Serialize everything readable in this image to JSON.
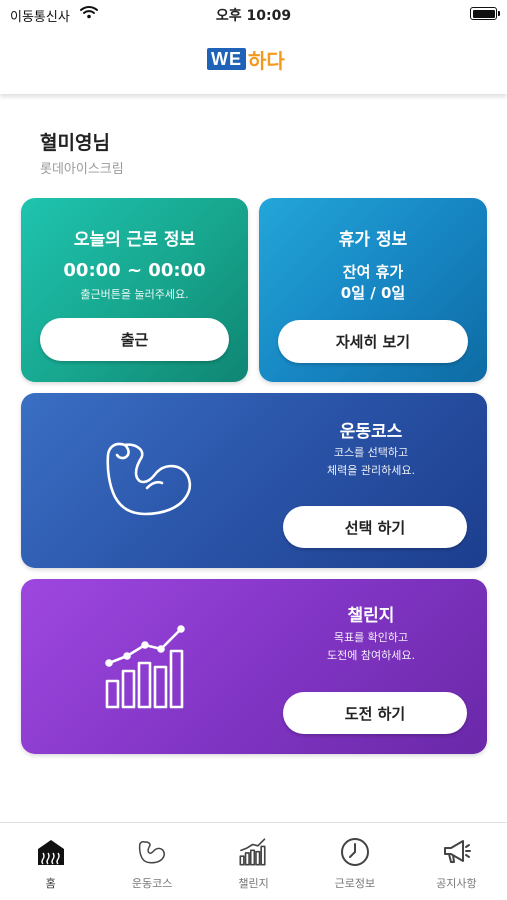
{
  "status_bar": {
    "carrier": "이동통신사",
    "time": "오후 10:09"
  },
  "header": {
    "logo_we": "WE",
    "logo_hada": "하다"
  },
  "user": {
    "name": "혈미영님",
    "company": "롯데아이스크림"
  },
  "work_card": {
    "title": "오늘의 근로 정보",
    "time_range": "00:00 ~ 00:00",
    "hint": "출근버튼을 눌러주세요.",
    "button_label": "출근"
  },
  "leave_card": {
    "title": "휴가 정보",
    "remain_label": "잔여 휴가",
    "remain_value": "0일 / 0일",
    "button_label": "자세히 보기"
  },
  "exercise_card": {
    "icon": "flexed-arm-icon",
    "title": "운동코스",
    "line1": "코스를 선택하고",
    "line2": "체력을 관리하세요.",
    "button_label": "선택 하기"
  },
  "challenge_card": {
    "icon": "bar-chart-trend-icon",
    "title": "챌린지",
    "line1": "목표를 확인하고",
    "line2": "도전에 참여하세요.",
    "button_label": "도전 하기"
  },
  "tabs": [
    {
      "label": "홈",
      "icon": "home-icon",
      "active": true
    },
    {
      "label": "운동코스",
      "icon": "flexed-arm-icon",
      "active": false
    },
    {
      "label": "챌린지",
      "icon": "bar-chart-icon",
      "active": false
    },
    {
      "label": "근로정보",
      "icon": "clock-icon",
      "active": false
    },
    {
      "label": "공지사항",
      "icon": "megaphone-icon",
      "active": false
    }
  ],
  "colors": {
    "work_card": "#17a58d",
    "leave_card": "#1684c1",
    "exercise_card": "#2a54a8",
    "challenge_card": "#8336c6",
    "logo_blue": "#1f63b8",
    "logo_orange": "#f39a1e"
  }
}
